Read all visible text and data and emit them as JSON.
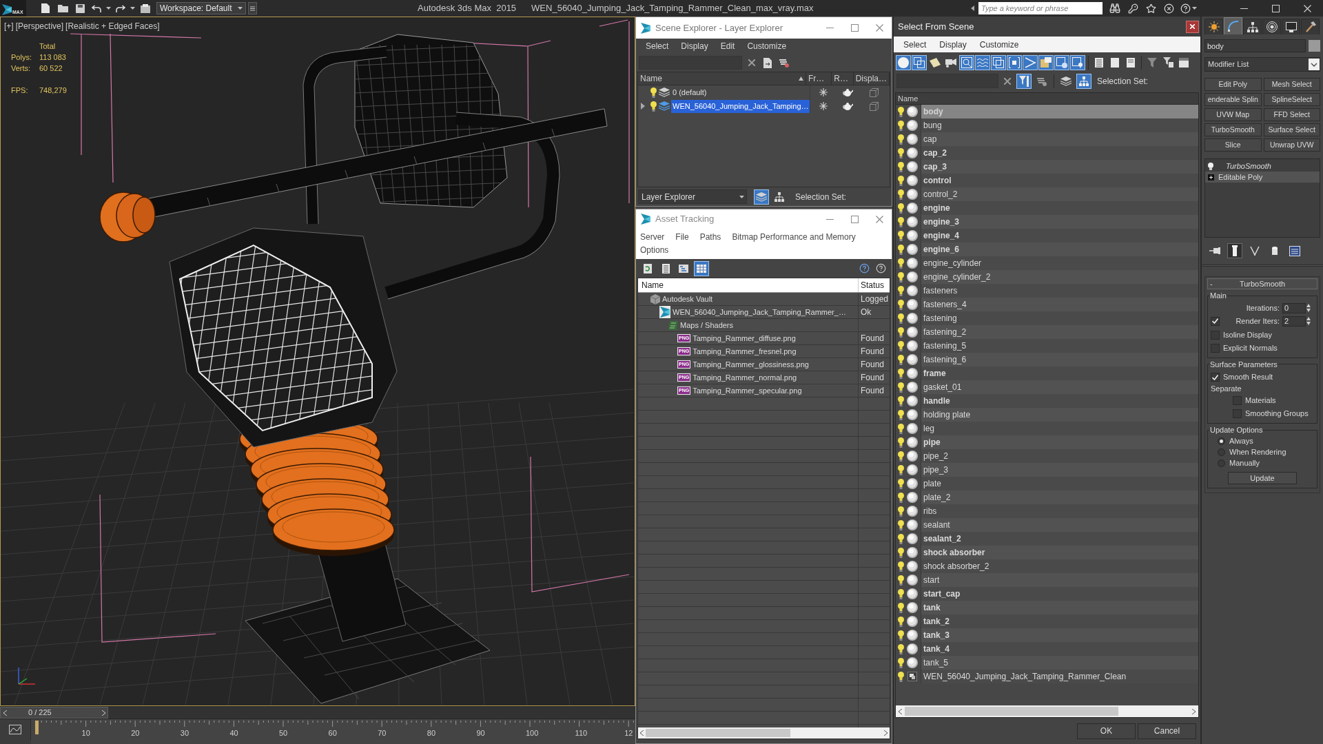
{
  "title_bar": {
    "logo_text": "MAX",
    "workspace": "Workspace: Default",
    "app_name": "Autodesk 3ds Max  2015",
    "file_name": "WEN_56040_Jumping_Jack_Tamping_Rammer_Clean_max_vray.max",
    "search": {
      "placeholder": "Type a keyword or phrase"
    }
  },
  "viewport": {
    "labels": [
      "[+]",
      "[Perspective]",
      "[Realistic + Edged Faces]"
    ],
    "stats_header": "Total",
    "stats": [
      {
        "label": "Polys:",
        "value": "113 083"
      },
      {
        "label": "Verts:",
        "value": "60 522"
      }
    ],
    "fps": {
      "label": "FPS:",
      "value": "748,279"
    }
  },
  "time_slider": {
    "frame": "0 / 225",
    "level": 0,
    "ticks": [
      "10",
      "20",
      "30",
      "40",
      "50",
      "60",
      "70",
      "80",
      "90",
      "100",
      "110",
      "12"
    ]
  },
  "scene_explorer": {
    "title": "Scene Explorer - Layer Explorer",
    "menu": [
      "Select",
      "Display",
      "Edit",
      "Customize"
    ],
    "columns": [
      "Name",
      "Fr…",
      "R…",
      "Displa…"
    ],
    "rows": [
      {
        "name": "0 (default)",
        "has_children": false,
        "selected": false
      },
      {
        "name": "WEN_56040_Jumping_Jack_Tamping…",
        "has_children": true,
        "selected": true
      }
    ],
    "explorer": "Layer Explorer",
    "layer_view_on": true,
    "hierarchy_view_on": false,
    "selection_set": "Selection Set:"
  },
  "asset_tracking": {
    "title": "Asset Tracking",
    "menu": [
      "Server",
      "File",
      "Paths",
      "Bitmap Performance and Memory",
      "Options"
    ],
    "views": [
      {
        "selected": false
      },
      {
        "selected": false
      },
      {
        "selected": false
      },
      {
        "selected": true
      }
    ],
    "columns": [
      "Name",
      "Status"
    ],
    "tree": [
      {
        "name": "Autodesk Vault",
        "status": "Logged",
        "kind": "vault",
        "children": [
          {
            "name": "WEN_56040_Jumping_Jack_Tamping_Rammer_…",
            "status": "Ok",
            "kind": "scene",
            "children": [
              {
                "name": "Maps / Shaders",
                "kind": "folder",
                "children": [
                  {
                    "name": "Tamping_Rammer_diffuse.png",
                    "status": "Found",
                    "kind": "image",
                    "file_type": "PNG"
                  },
                  {
                    "name": "Tamping_Rammer_fresnel.png",
                    "status": "Found",
                    "kind": "image",
                    "file_type": "PNG"
                  },
                  {
                    "name": "Tamping_Rammer_glossiness.png",
                    "status": "Found",
                    "kind": "image",
                    "file_type": "PNG"
                  },
                  {
                    "name": "Tamping_Rammer_normal.png",
                    "status": "Found",
                    "kind": "image",
                    "file_type": "PNG"
                  },
                  {
                    "name": "Tamping_Rammer_specular.png",
                    "status": "Found",
                    "kind": "image",
                    "file_type": "PNG"
                  }
                ]
              }
            ]
          }
        ]
      }
    ]
  },
  "select_from_scene": {
    "title": "Select From Scene",
    "menu": [
      "Select",
      "Display",
      "Customize"
    ],
    "filters": [
      {
        "on": true
      },
      {
        "on": true
      },
      {
        "on": false
      },
      {
        "on": false
      },
      {
        "on": true
      },
      {
        "on": true
      },
      {
        "on": true
      },
      {
        "on": true
      },
      {
        "on": true
      },
      {
        "on": true
      },
      {
        "on": true
      },
      {
        "on": true
      }
    ],
    "display_filter_on": true,
    "layer_view_on": false,
    "hierarchy_view_on": true,
    "selection_set": "Selection Set:",
    "column": "Name",
    "items": [
      {
        "name": "body",
        "kind": "object",
        "bold": true,
        "selected": true
      },
      {
        "name": "bung",
        "kind": "object",
        "bold": false,
        "selected": false
      },
      {
        "name": "cap",
        "kind": "object",
        "bold": false,
        "selected": false
      },
      {
        "name": "cap_2",
        "kind": "object",
        "bold": true,
        "selected": false
      },
      {
        "name": "cap_3",
        "kind": "object",
        "bold": true,
        "selected": false
      },
      {
        "name": "control",
        "kind": "object",
        "bold": true,
        "selected": false
      },
      {
        "name": "control_2",
        "kind": "object",
        "bold": false,
        "selected": false
      },
      {
        "name": "engine",
        "kind": "object",
        "bold": true,
        "selected": false
      },
      {
        "name": "engine_3",
        "kind": "object",
        "bold": true,
        "selected": false
      },
      {
        "name": "engine_4",
        "kind": "object",
        "bold": true,
        "selected": false
      },
      {
        "name": "engine_6",
        "kind": "object",
        "bold": true,
        "selected": false
      },
      {
        "name": "engine_cylinder",
        "kind": "object",
        "bold": false,
        "selected": false
      },
      {
        "name": "engine_cylinder_2",
        "kind": "object",
        "bold": false,
        "selected": false
      },
      {
        "name": "fasteners",
        "kind": "object",
        "bold": false,
        "selected": false
      },
      {
        "name": "fasteners_4",
        "kind": "object",
        "bold": false,
        "selected": false
      },
      {
        "name": "fastening",
        "kind": "object",
        "bold": false,
        "selected": false
      },
      {
        "name": "fastening_2",
        "kind": "object",
        "bold": false,
        "selected": false
      },
      {
        "name": "fastening_5",
        "kind": "object",
        "bold": false,
        "selected": false
      },
      {
        "name": "fastening_6",
        "kind": "object",
        "bold": false,
        "selected": false
      },
      {
        "name": "frame",
        "kind": "object",
        "bold": true,
        "selected": false
      },
      {
        "name": "gasket_01",
        "kind": "object",
        "bold": false,
        "selected": false
      },
      {
        "name": "handle",
        "kind": "object",
        "bold": true,
        "selected": false
      },
      {
        "name": "holding plate",
        "kind": "object",
        "bold": false,
        "selected": false
      },
      {
        "name": "leg",
        "kind": "object",
        "bold": false,
        "selected": false
      },
      {
        "name": "pipe",
        "kind": "object",
        "bold": true,
        "selected": false
      },
      {
        "name": "pipe_2",
        "kind": "object",
        "bold": false,
        "selected": false
      },
      {
        "name": "pipe_3",
        "kind": "object",
        "bold": false,
        "selected": false
      },
      {
        "name": "plate",
        "kind": "object",
        "bold": false,
        "selected": false
      },
      {
        "name": "plate_2",
        "kind": "object",
        "bold": false,
        "selected": false
      },
      {
        "name": "ribs",
        "kind": "object",
        "bold": false,
        "selected": false
      },
      {
        "name": "sealant",
        "kind": "object",
        "bold": false,
        "selected": false
      },
      {
        "name": "sealant_2",
        "kind": "object",
        "bold": true,
        "selected": false
      },
      {
        "name": "shock absorber",
        "kind": "object",
        "bold": true,
        "selected": false
      },
      {
        "name": "shock absorber_2",
        "kind": "object",
        "bold": false,
        "selected": false
      },
      {
        "name": "start",
        "kind": "object",
        "bold": false,
        "selected": false
      },
      {
        "name": "start_cap",
        "kind": "object",
        "bold": true,
        "selected": false
      },
      {
        "name": "tank",
        "kind": "object",
        "bold": true,
        "selected": false
      },
      {
        "name": "tank_2",
        "kind": "object",
        "bold": true,
        "selected": false
      },
      {
        "name": "tank_3",
        "kind": "object",
        "bold": true,
        "selected": false
      },
      {
        "name": "tank_4",
        "kind": "object",
        "bold": true,
        "selected": false
      },
      {
        "name": "tank_5",
        "kind": "object",
        "bold": false,
        "selected": false
      },
      {
        "name": "WEN_56040_Jumping_Jack_Tamping_Rammer_Clean",
        "kind": "container",
        "bold": false,
        "selected": false
      }
    ],
    "buttons": [
      "OK",
      "Cancel"
    ]
  },
  "command_panel": {
    "tabs": [
      {
        "selected": false
      },
      {
        "selected": true
      },
      {
        "selected": false
      },
      {
        "selected": false
      },
      {
        "selected": false
      },
      {
        "selected": false
      }
    ],
    "object_name": "body",
    "modifier_list": "Modifier List",
    "buttons": [
      "Edit Poly",
      "Mesh Select",
      "enderable Splin",
      "SplineSelect",
      "UVW Map",
      "FFD Select",
      "TurboSmooth",
      "Surface Select",
      "Slice",
      "Unwrap UVW"
    ],
    "stack": [
      {
        "name": "TurboSmooth",
        "kind": "modifier",
        "selected": false
      },
      {
        "name": "Editable Poly",
        "kind": "object",
        "selected": true
      }
    ],
    "stack_tools": [
      {
        "on": false
      },
      {
        "on": true
      },
      {
        "on": false
      },
      {
        "on": false
      },
      {
        "on": false
      }
    ],
    "rollout": {
      "toggle": "-",
      "title": "TurboSmooth",
      "groups": [
        {
          "title": "Main",
          "controls": [
            {
              "kind": "spinner",
              "label": "Iterations:",
              "value": "0"
            },
            {
              "kind": "check_spinner",
              "label": "Render Iters:",
              "value": "2",
              "checked": true
            },
            {
              "kind": "checkbox",
              "label": "Isoline Display",
              "checked": false
            },
            {
              "kind": "checkbox",
              "label": "Explicit Normals",
              "checked": false
            }
          ]
        },
        {
          "title": "Surface Parameters",
          "controls": [
            {
              "kind": "checkbox",
              "label": "Smooth Result",
              "checked": true
            },
            {
              "kind": "label",
              "label": "Separate",
              "children": [
                {
                  "kind": "checkbox",
                  "label": "Materials",
                  "checked": false
                },
                {
                  "kind": "checkbox",
                  "label": "Smoothing Groups",
                  "checked": false
                }
              ]
            }
          ]
        },
        {
          "title": "Update Options",
          "controls": [
            {
              "kind": "radio",
              "label": "Always",
              "selected": true
            },
            {
              "kind": "radio",
              "label": "When Rendering",
              "selected": false
            },
            {
              "kind": "radio",
              "label": "Manually",
              "selected": false
            },
            {
              "kind": "button",
              "label": "Update"
            }
          ]
        }
      ]
    }
  }
}
